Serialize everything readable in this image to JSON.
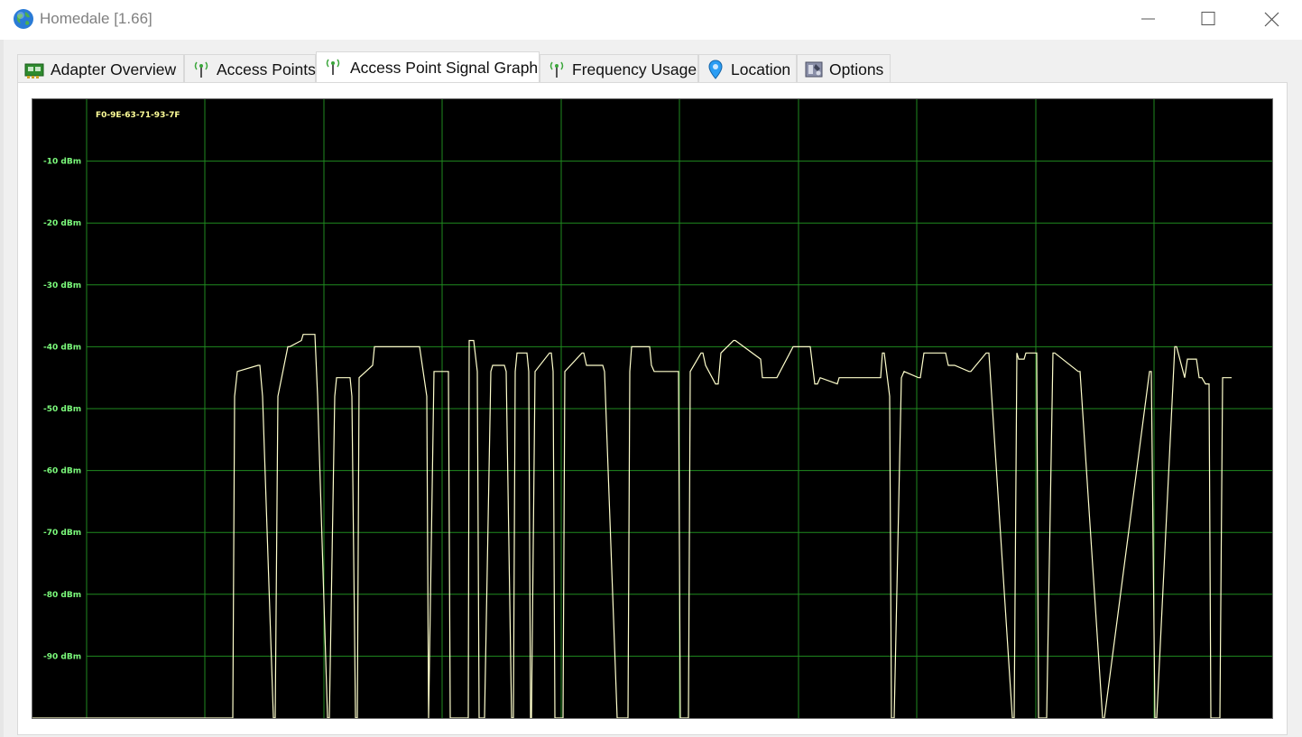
{
  "window": {
    "title": "Homedale [1.66]",
    "controls": [
      "minimize",
      "maximize",
      "close"
    ]
  },
  "tabs": [
    {
      "label": "Adapter Overview",
      "icon": "adapter-icon",
      "active": false
    },
    {
      "label": "Access Points",
      "icon": "antenna-icon",
      "active": false
    },
    {
      "label": "Access Point Signal Graph",
      "icon": "antenna-icon",
      "active": true
    },
    {
      "label": "Frequency Usage",
      "icon": "antenna-icon",
      "active": false
    },
    {
      "label": "Location",
      "icon": "map-pin-icon",
      "active": false
    },
    {
      "label": "Options",
      "icon": "options-icon",
      "active": false
    }
  ],
  "graph": {
    "access_point_label": "F0-9E-63-71-93-7F",
    "y_tick_labels": [
      "-10 dBm",
      "-20 dBm",
      "-30 dBm",
      "-40 dBm",
      "-50 dBm",
      "-60 dBm",
      "-70 dBm",
      "-80 dBm",
      "-90 dBm"
    ],
    "colors": {
      "background": "#000000",
      "grid": "#1f8a1f",
      "tick_labels": "#7cfc7c",
      "signal_line": "#ffffcc",
      "ap_label": "#ffff99"
    }
  },
  "chart_data": {
    "type": "line",
    "title": "",
    "xlabel": "",
    "ylabel": "",
    "ylim": [
      -100,
      0
    ],
    "xlim": [
      0,
      1374
    ],
    "grid": true,
    "x": [
      0,
      222,
      224,
      227,
      250,
      252,
      255,
      267,
      269,
      272,
      283,
      285,
      298,
      300,
      313,
      316,
      327,
      329,
      335,
      337,
      352,
      354,
      358,
      360,
      362,
      377,
      379,
      427,
      429,
      437,
      439,
      445,
      461,
      463,
      483,
      484,
      485,
      489,
      493,
      495,
      501,
      508,
      510,
      523,
      525,
      531,
      533,
      535,
      537,
      548,
      550,
      552,
      553,
      557,
      573,
      575,
      577,
      579,
      588,
      590,
      609,
      611,
      614,
      632,
      634,
      648,
      660,
      662,
      664,
      684,
      686,
      689,
      716,
      718,
      727,
      729,
      741,
      743,
      746,
      757,
      760,
      763,
      777,
      779,
      807,
      809,
      825,
      843,
      862,
      867,
      870,
      873,
      892,
      894,
      940,
      942,
      944,
      950,
      952,
      955,
      963,
      966,
      982,
      984,
      988,
      1012,
      1015,
      1022,
      1038,
      1040,
      1057,
      1060,
      1086,
      1088,
      1091,
      1093,
      1099,
      1101,
      1113,
      1115,
      1122,
      1124,
      1131,
      1133,
      1159,
      1161,
      1186,
      1188,
      1238,
      1240,
      1244,
      1246,
      1266,
      1268,
      1277,
      1280,
      1290,
      1293,
      1296,
      1300,
      1304,
      1306,
      1316,
      1319,
      1329,
      1351,
      1354,
      1358,
      1374
    ],
    "series": [
      {
        "values": [
          -100,
          -100,
          -48,
          -44,
          -43,
          -43,
          -48,
          -100,
          -100,
          -48,
          -40,
          -40,
          -39,
          -38,
          -38,
          -48,
          -100,
          -100,
          -48,
          -45,
          -45,
          -48,
          -100,
          -100,
          -45,
          -43,
          -40,
          -40,
          -40,
          -48,
          -100,
          -44,
          -44,
          -100,
          -100,
          -39,
          -39,
          -39,
          -44,
          -100,
          -100,
          -44,
          -43,
          -43,
          -44,
          -100,
          -100,
          -44,
          -41,
          -41,
          -44,
          -100,
          -100,
          -44,
          -41,
          -41,
          -44,
          -100,
          -100,
          -44,
          -41,
          -41,
          -43,
          -43,
          -44,
          -100,
          -100,
          -44,
          -40,
          -40,
          -43,
          -44,
          -44,
          -100,
          -100,
          -44,
          -41,
          -41,
          -43,
          -46,
          -46,
          -41,
          -39,
          -39,
          -42,
          -45,
          -45,
          -40,
          -40,
          -46,
          -46,
          -45,
          -46,
          -45,
          -45,
          -41,
          -41,
          -48,
          -100,
          -100,
          -45,
          -44,
          -45,
          -45,
          -41,
          -41,
          -43,
          -43,
          -44,
          -44,
          -41,
          -41,
          -100,
          -100,
          -41,
          -42,
          -42,
          -41,
          -41,
          -100,
          -100,
          -100,
          -41,
          -41,
          -44,
          -44,
          -100,
          -100,
          -44,
          -44,
          -100,
          -100,
          -40,
          -40,
          -45,
          -42,
          -42,
          -45,
          -45,
          -46,
          -46,
          -100,
          -100,
          -45,
          -45
        ]
      }
    ]
  }
}
